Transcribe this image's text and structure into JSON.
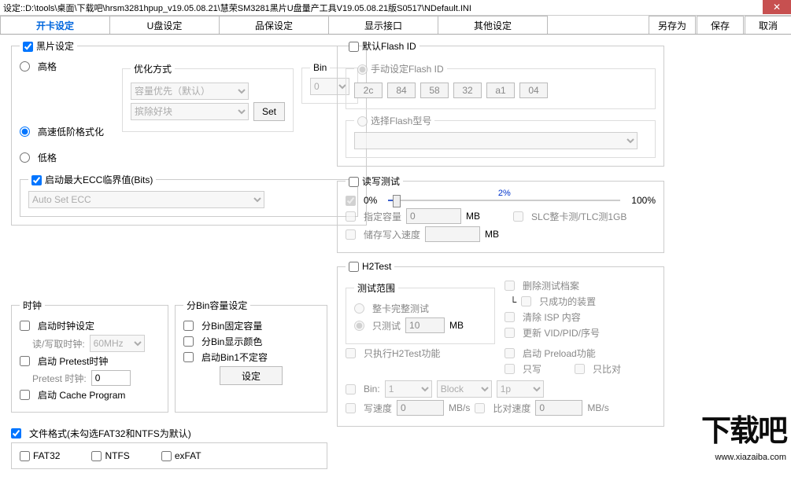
{
  "title": "设定::D:\\tools\\桌面\\下载吧\\hrsm3281hpup_v19.05.08.21\\慧荣SM3281黑片U盘量产工具V19.05.08.21版S0517\\NDefault.INI",
  "tabs": [
    "开卡设定",
    "U盘设定",
    "品保设定",
    "显示接口",
    "其他设定"
  ],
  "btns": {
    "saveAs": "另存为",
    "save": "保存",
    "cancel": "取消",
    "close": "✕"
  },
  "bp": {
    "legend": "黑片设定",
    "r_high": "高格",
    "r_fast": "高速低阶格式化",
    "r_low": "低格",
    "opt_label": "优化方式",
    "opt_sel": "容量优先（默认）",
    "opt_sel2": "摈除好块",
    "bin_label": "Bin",
    "bin_val": "0",
    "set": "Set",
    "ecc_cb": "启动最大ECC临界值(Bits)",
    "ecc_sel": "Auto Set ECC"
  },
  "clk": {
    "legend": "时钟",
    "cb1": "启动时钟设定",
    "lbl1": "读/写取时钟:",
    "sel1": "60MHz",
    "cb2": "启动 Pretest时钟",
    "lbl2": "Pretest 时钟:",
    "val2": "0",
    "cb3": "启动 Cache Program"
  },
  "bincap": {
    "legend": "分Bin容量设定",
    "cb1": "分Bin固定容量",
    "cb2": "分Bin显示颜色",
    "cb3": "启动Bin1不定容",
    "btn": "设定"
  },
  "ff": {
    "cb": "文件格式(未勾选FAT32和NTFS为默认)",
    "f1": "FAT32",
    "f2": "NTFS",
    "f3": "exFAT"
  },
  "fid": {
    "legend": "默认Flash ID",
    "r1": "手动设定Flash ID",
    "hex": [
      "2c",
      "84",
      "58",
      "32",
      "a1",
      "04"
    ],
    "r2": "选择Flash型号"
  },
  "rw": {
    "legend": "读写测试",
    "p0": "0%",
    "perc": "2%",
    "p100": "100%",
    "cb_cap": "指定容量",
    "cap_val": "0",
    "mb": "MB",
    "cb_slc": "SLC整卡测/TLC测1GB",
    "cb_spd": "储存写入速度"
  },
  "h2": {
    "legend": "H2Test",
    "scope": "测试范围",
    "r_full": "整卡完整测试",
    "r_only": "只测试",
    "only_val": "10",
    "mb": "MB",
    "cb_h2only": "只执行H2Test功能",
    "cb_del": "删除测试档案",
    "cb_succ": "只成功的装置",
    "cb_isp": "清除 ISP 内容",
    "cb_vid": "更新 VID/PID/序号",
    "cb_pre": "启动 Preload功能",
    "cb_w": "只写",
    "cb_cmp": "只比对",
    "bin_l": "Bin:",
    "bin_v": "1",
    "block": "Block",
    "p1": "1p",
    "ws": "写速度",
    "ws_v": "0",
    "mbs": "MB/s",
    "cmp": "比对速度",
    "cmp_v": "0"
  },
  "wm": {
    "txt": "下载吧",
    "url": "www.xiazaiba.com"
  }
}
